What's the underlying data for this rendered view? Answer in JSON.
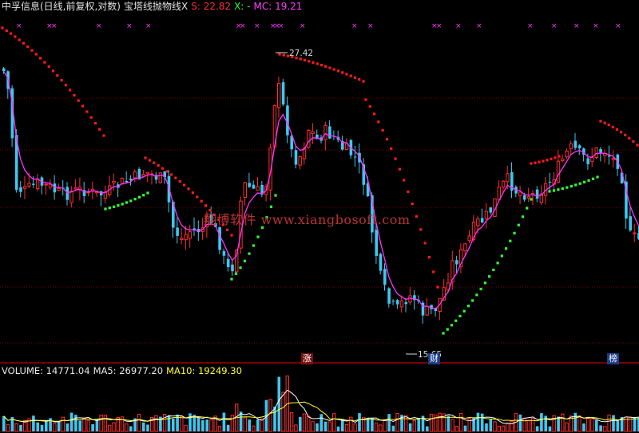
{
  "header": {
    "stock": "中孚信息(日线,前复权,对数)",
    "indicator": "宝塔线抛物线X",
    "s_label": "S: 22.82",
    "x_label": "X: -",
    "mc_label": "MC: 19.21"
  },
  "volume_header": {
    "volume_label": "VOLUME: 14771.04",
    "ma5_label": "MA5: 26977.20",
    "ma10_label": "MA10: 19249.30"
  },
  "watermark": "翔博软件 www.xiangbosoft.com",
  "annotations": {
    "high_label": "27.42",
    "low_label": "15.65"
  },
  "badges": [
    {
      "text": "涨",
      "color": "#b02020"
    },
    {
      "text": "财",
      "color": "#2050c0"
    },
    {
      "text": "榜",
      "color": "#2050c0"
    }
  ],
  "colors": {
    "background": "#000000",
    "candle_up": "#ff2d2d",
    "candle_down": "#3cc8f0",
    "sar_bull": "#33ff33",
    "sar_bear": "#ff1a1a",
    "mc_line": "#ff33ff",
    "ma5": "#ffffff",
    "ma10": "#ffff33",
    "grid": "#7a0000",
    "signal": "#ff33ff"
  },
  "chart_data": [
    {
      "type": "candlestick",
      "title": "中孚信息(日线,前复权,对数)",
      "price_range": [
        14.6,
        31.5
      ],
      "high": 27.42,
      "low": 15.65,
      "series": [
        {
          "name": "S",
          "last": 22.82
        },
        {
          "name": "MC",
          "last": 19.21
        }
      ]
    },
    {
      "type": "bar",
      "title": "VOLUME",
      "series": [
        {
          "name": "VOLUME",
          "last": 14771.04
        },
        {
          "name": "MA5",
          "last": 26977.2
        },
        {
          "name": "MA10",
          "last": 19249.3
        }
      ]
    }
  ]
}
